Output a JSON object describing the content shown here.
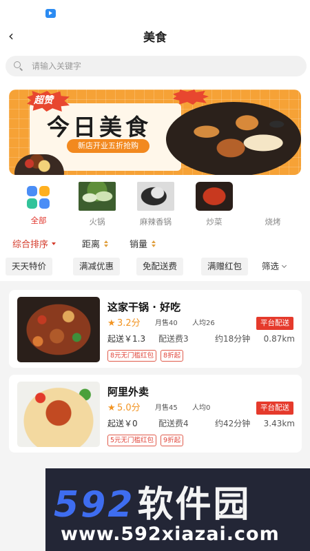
{
  "header": {
    "title": "美食",
    "back_icon": "chevron-left-icon"
  },
  "search": {
    "placeholder": "请输入关键字"
  },
  "banner": {
    "badge": "超赞",
    "title": "今日美食",
    "promo": "新店开业五折抢购"
  },
  "categories": [
    {
      "label": "全部",
      "active": true,
      "icon": "grid-icon"
    },
    {
      "label": "火锅",
      "active": false
    },
    {
      "label": "麻辣香锅",
      "active": false
    },
    {
      "label": "炒菜",
      "active": false
    },
    {
      "label": "烧烤",
      "active": false
    }
  ],
  "sort": {
    "items": [
      {
        "label": "综合排序",
        "active": true
      },
      {
        "label": "距离",
        "active": false
      },
      {
        "label": "销量",
        "active": false
      }
    ]
  },
  "filters": {
    "chips": [
      "天天特价",
      "满减优惠",
      "免配送费",
      "满赠红包"
    ],
    "filter_label": "筛选"
  },
  "shops": [
    {
      "name": "这家干锅 · 好吃",
      "score": "3.2分",
      "monthly_sales": "月售40",
      "avg_price": "人均26",
      "delivery_tag": "平台配送",
      "min_order": "起送￥1.3",
      "delivery_fee": "配送费3",
      "eta": "约18分钟",
      "distance": "0.87km",
      "coupons": [
        "8元无门槛红包",
        "8折起"
      ]
    },
    {
      "name": "阿里外卖",
      "score": "5.0分",
      "monthly_sales": "月售45",
      "avg_price": "人均0",
      "delivery_tag": "平台配送",
      "min_order": "起送￥0",
      "delivery_fee": "配送费4",
      "eta": "约42分钟",
      "distance": "3.43km",
      "coupons": [
        "5元无门槛红包",
        "9折起"
      ]
    }
  ],
  "watermark": {
    "logo": "592",
    "logo_cn": "软件园",
    "url": "www.592xiazai.com"
  },
  "colors": {
    "accent": "#e0342a",
    "star": "#f29422",
    "banner": "#f6a236"
  }
}
